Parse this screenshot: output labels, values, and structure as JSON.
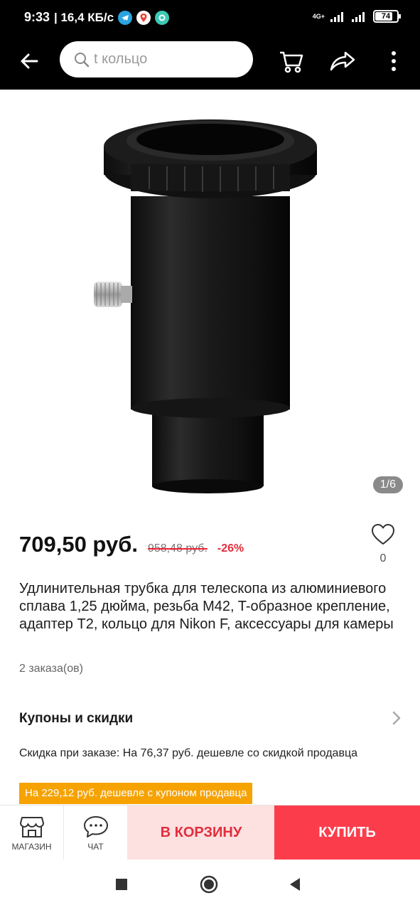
{
  "status_bar": {
    "time": "9:33",
    "speed": "| 16,4 КБ/с",
    "network": "4G+",
    "battery": "74",
    "battery_level": 0.74
  },
  "header": {
    "search_placeholder": "t кольцо",
    "icons": [
      "back-arrow-icon",
      "search-icon",
      "cart-icon",
      "share-icon",
      "more-icon"
    ]
  },
  "gallery": {
    "pager": "1/6"
  },
  "product": {
    "price": "709,50 руб.",
    "old_price": "958,48 руб.",
    "discount": "-26%",
    "wishlist_count": "0",
    "title": "Удлинительная трубка для телескопа из алюминиевого сплава 1,25 дюйма, резьба M42, T-образное крепление, адаптер T2, кольцо для Nikon F, аксессуары для камеры",
    "orders": "2 заказа(ов)"
  },
  "coupons": {
    "heading": "Купоны и скидки",
    "discount_text": "Скидка при заказе: На 76,37 руб. дешевле со скидкой продавца",
    "coupon_tag": "На 229,12 руб. дешевле с купоном продавца"
  },
  "action_bar": {
    "store_label": "МАГАЗИН",
    "chat_label": "ЧАТ",
    "cart_label": "В КОРЗИНУ",
    "buy_label": "КУПИТЬ"
  },
  "colors": {
    "accent_red": "#fb3d4b",
    "price_red": "#e22d3c",
    "coupon_orange": "#f6a200"
  }
}
